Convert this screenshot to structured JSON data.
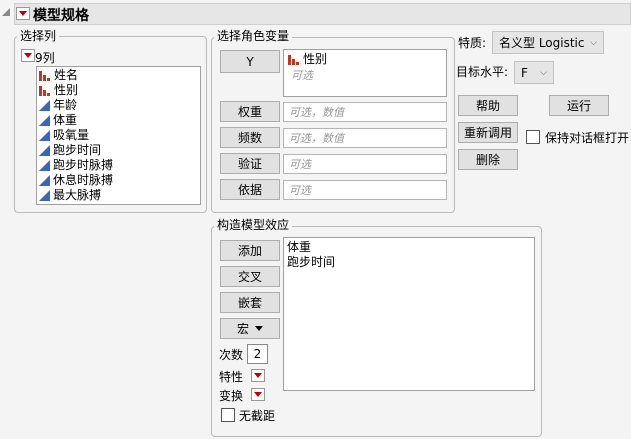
{
  "title": "模型规格",
  "select_columns": {
    "legend": "选择列",
    "count_label": "9列",
    "columns": [
      {
        "name": "姓名",
        "type": "nominal"
      },
      {
        "name": "性别",
        "type": "nominal"
      },
      {
        "name": "年龄",
        "type": "continuous"
      },
      {
        "name": "体重",
        "type": "continuous"
      },
      {
        "name": "吸氧量",
        "type": "continuous"
      },
      {
        "name": "跑步时间",
        "type": "continuous"
      },
      {
        "name": "跑步时脉搏",
        "type": "continuous"
      },
      {
        "name": "休息时脉搏",
        "type": "continuous"
      },
      {
        "name": "最大脉搏",
        "type": "continuous"
      }
    ]
  },
  "roles": {
    "legend": "选择角色变量",
    "y": {
      "label": "Y",
      "value": "性别",
      "placeholder": "可选"
    },
    "weight": {
      "label": "权重",
      "placeholder": "可选，数值"
    },
    "freq": {
      "label": "频数",
      "placeholder": "可选，数值"
    },
    "validation": {
      "label": "验证",
      "placeholder": "可选"
    },
    "by": {
      "label": "依据",
      "placeholder": "可选"
    }
  },
  "personality": {
    "label": "特质:",
    "value": "名义型 Logistic"
  },
  "target_level": {
    "label": "目标水平:",
    "value": "F"
  },
  "actions": {
    "help": "帮助",
    "run": "运行",
    "recall": "重新调用",
    "remove": "删除",
    "keep_open": "保持对话框打开"
  },
  "effects": {
    "legend": "构造模型效应",
    "add": "添加",
    "cross": "交叉",
    "nest": "嵌套",
    "macros": "宏",
    "degree_label": "次数",
    "degree": "2",
    "attributes": "特性",
    "transform": "变换",
    "no_intercept": "无截距",
    "terms": [
      "体重",
      "跑步时间"
    ]
  }
}
